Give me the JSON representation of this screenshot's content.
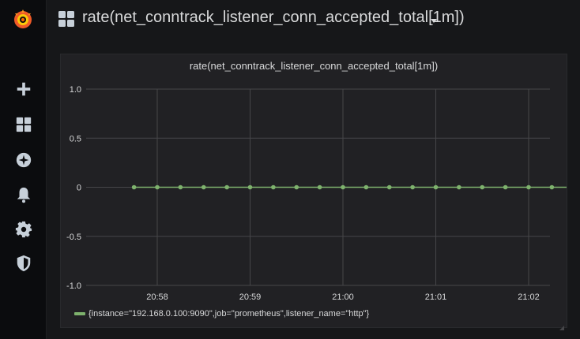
{
  "topbar": {
    "dashboard_title": "rate(net_conntrack_listener_conn_accepted_total[1m])"
  },
  "sidemenu": {
    "items": [
      {
        "icon": "plus-icon",
        "label": "Create"
      },
      {
        "icon": "dashboards-icon",
        "label": "Dashboards"
      },
      {
        "icon": "compass-icon",
        "label": "Explore"
      },
      {
        "icon": "bell-icon",
        "label": "Alerting"
      },
      {
        "icon": "gear-icon",
        "label": "Configuration"
      },
      {
        "icon": "shield-icon",
        "label": "Server Admin"
      }
    ]
  },
  "panel": {
    "title": "rate(net_conntrack_listener_conn_accepted_total[1m])"
  },
  "colors": {
    "series": "#7eb26d",
    "grid": "#464649",
    "axis_text": "#d8d9da"
  },
  "chart_data": {
    "type": "line",
    "title": "rate(net_conntrack_listener_conn_accepted_total[1m])",
    "xlabel": "",
    "ylabel": "",
    "ylim": [
      -1.0,
      1.0
    ],
    "y_ticks": [
      "1.0",
      "0.5",
      "0",
      "-0.5",
      "-1.0"
    ],
    "x_ticks": [
      "20:58",
      "20:59",
      "21:00",
      "21:01",
      "21:02"
    ],
    "x_unit": "minutes",
    "xlim": [
      0,
      60
    ],
    "grid": true,
    "legend_position": "bottom-left",
    "series": [
      {
        "name": "{instance=\"192.168.0.100:9090\",job=\"prometheus\",listener_name=\"http\"}",
        "x": [
          "20:57:45",
          "20:58:00",
          "20:58:15",
          "20:58:30",
          "20:58:45",
          "20:59:00",
          "20:59:15",
          "20:59:30",
          "20:59:45",
          "21:00:00",
          "21:00:15",
          "21:00:30",
          "21:00:45",
          "21:01:00",
          "21:01:15",
          "21:01:30",
          "21:01:45",
          "21:02:00",
          "21:02:15",
          "21:02:30"
        ],
        "values": [
          0,
          0,
          0,
          0,
          0,
          0,
          0,
          0,
          0,
          0,
          0,
          0,
          0,
          0,
          0,
          0,
          0,
          0,
          0,
          0
        ]
      }
    ]
  }
}
